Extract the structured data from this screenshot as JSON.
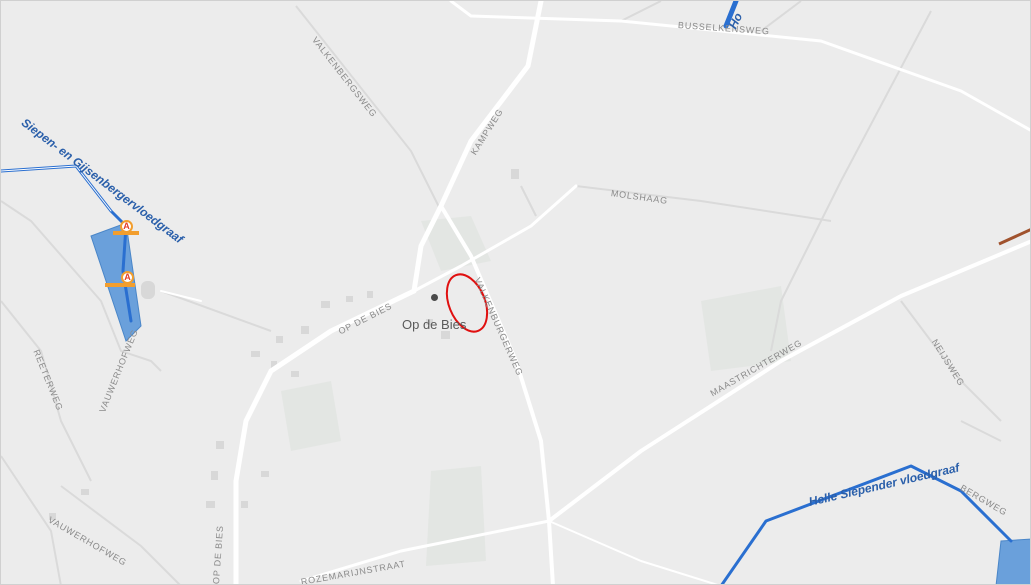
{
  "streets": {
    "busselkensweg": "BUSSELKENSWEG",
    "valkenbergsweg": "VALKENBERGSWEG",
    "kampweg": "KAMPWEG",
    "molshaag": "MOLSHAAG",
    "valkenburgerweg": "VALKENBURGERWEG",
    "op_de_bies_road": "OP DE BIES",
    "op_de_bies_road_2": "OP DE BIES",
    "maastrichterweg": "MAASTRICHTERWEG",
    "neijsweg": "NEIJSWEG",
    "vauwerhofweg_1": "VAUWERHOFWEG",
    "vauwerhofweg_2": "VAUWERHOFWEG",
    "reeterweg": "REETERWEG",
    "rozemarijnstraat": "ROZEMARIJNSTRAAT",
    "bergweg": "BERGWEG"
  },
  "waterways": {
    "siepen": "Siepen- en Gijsenbergervloedgraaf",
    "helle": "Helle Siepender vloedgraaf",
    "top": "Ho"
  },
  "place": {
    "name": "Op de Bies"
  },
  "markers": {
    "a1": "A",
    "a2": "A"
  },
  "colors": {
    "background": "#ececec",
    "road": "#ffffff",
    "water": "#2a6fd0",
    "water_area": "#6aa0db",
    "highlight": "#e01010",
    "marker_border": "#f29e2e"
  }
}
